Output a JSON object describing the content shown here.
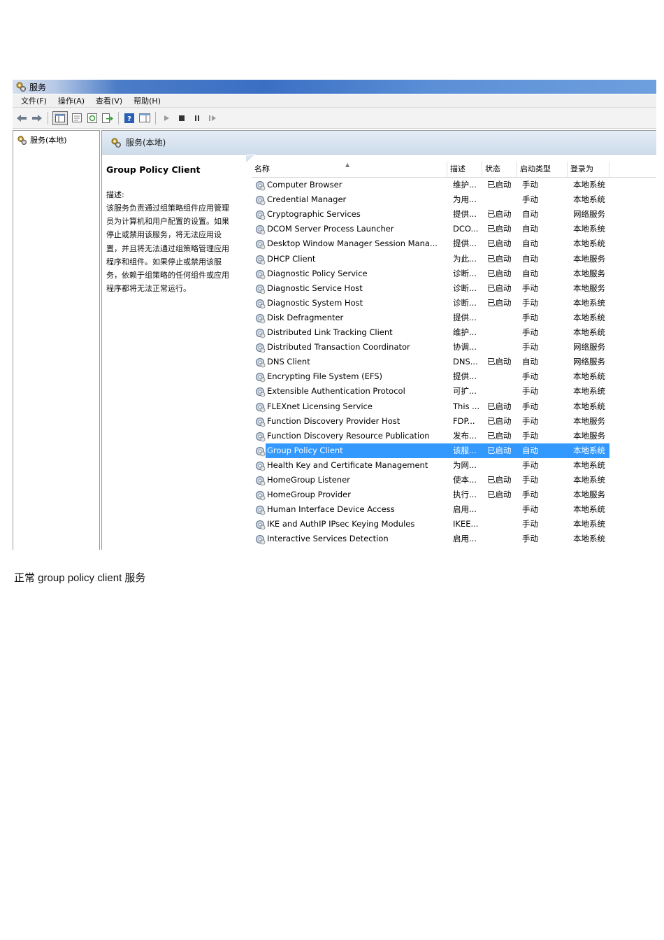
{
  "window": {
    "title": "服务",
    "menu": [
      "文件(F)",
      "操作(A)",
      "查看(V)",
      "帮助(H)"
    ],
    "toolbar_icons": [
      "back-icon",
      "forward-icon",
      "console-tree-icon",
      "properties-icon",
      "refresh-icon",
      "export-icon",
      "help-icon",
      "view-icon",
      "play-icon",
      "stop-icon",
      "pause-icon",
      "restart-icon"
    ]
  },
  "tree": {
    "root": "服务(本地)"
  },
  "panel": {
    "header": "服务(本地)",
    "desc_title": "Group Policy Client",
    "desc_label": "描述:",
    "desc_lines": [
      "该服务负责通过组策略组件应用管理",
      "员为计算机和用户配置的设置。如果",
      "停止或禁用该服务，将无法应用设",
      "置，并且将无法通过组策略管理应用",
      "程序和组件。如果停止或禁用该服",
      "务，依赖于组策略的任何组件或应用",
      "程序都将无法正常运行。"
    ]
  },
  "columns": [
    "名称",
    "描述",
    "状态",
    "启动类型",
    "登录为"
  ],
  "services": [
    {
      "name": "Computer Browser",
      "desc": "维护...",
      "status": "已启动",
      "start": "手动",
      "logon": "本地系统"
    },
    {
      "name": "Credential Manager",
      "desc": "为用...",
      "status": "",
      "start": "手动",
      "logon": "本地系统"
    },
    {
      "name": "Cryptographic Services",
      "desc": "提供...",
      "status": "已启动",
      "start": "自动",
      "logon": "网络服务"
    },
    {
      "name": "DCOM Server Process Launcher",
      "desc": "DCO...",
      "status": "已启动",
      "start": "自动",
      "logon": "本地系统"
    },
    {
      "name": "Desktop Window Manager Session Mana...",
      "desc": "提供...",
      "status": "已启动",
      "start": "自动",
      "logon": "本地系统"
    },
    {
      "name": "DHCP Client",
      "desc": "为此...",
      "status": "已启动",
      "start": "自动",
      "logon": "本地服务"
    },
    {
      "name": "Diagnostic Policy Service",
      "desc": "诊断...",
      "status": "已启动",
      "start": "自动",
      "logon": "本地服务"
    },
    {
      "name": "Diagnostic Service Host",
      "desc": "诊断...",
      "status": "已启动",
      "start": "手动",
      "logon": "本地服务"
    },
    {
      "name": "Diagnostic System Host",
      "desc": "诊断...",
      "status": "已启动",
      "start": "手动",
      "logon": "本地系统"
    },
    {
      "name": "Disk Defragmenter",
      "desc": "提供...",
      "status": "",
      "start": "手动",
      "logon": "本地系统"
    },
    {
      "name": "Distributed Link Tracking Client",
      "desc": "维护...",
      "status": "",
      "start": "手动",
      "logon": "本地系统"
    },
    {
      "name": "Distributed Transaction Coordinator",
      "desc": "协调...",
      "status": "",
      "start": "手动",
      "logon": "网络服务"
    },
    {
      "name": "DNS Client",
      "desc": "DNS...",
      "status": "已启动",
      "start": "自动",
      "logon": "网络服务"
    },
    {
      "name": "Encrypting File System (EFS)",
      "desc": "提供...",
      "status": "",
      "start": "手动",
      "logon": "本地系统"
    },
    {
      "name": "Extensible Authentication Protocol",
      "desc": "可扩...",
      "status": "",
      "start": "手动",
      "logon": "本地系统"
    },
    {
      "name": "FLEXnet Licensing Service",
      "desc": "This ...",
      "status": "已启动",
      "start": "手动",
      "logon": "本地系统"
    },
    {
      "name": "Function Discovery Provider Host",
      "desc": "FDP...",
      "status": "已启动",
      "start": "手动",
      "logon": "本地服务"
    },
    {
      "name": "Function Discovery Resource Publication",
      "desc": "发布...",
      "status": "已启动",
      "start": "手动",
      "logon": "本地服务"
    },
    {
      "name": "Group Policy Client",
      "desc": "该服...",
      "status": "已启动",
      "start": "自动",
      "logon": "本地系统",
      "selected": true
    },
    {
      "name": "Health Key and Certificate Management",
      "desc": "为网...",
      "status": "",
      "start": "手动",
      "logon": "本地系统"
    },
    {
      "name": "HomeGroup Listener",
      "desc": "使本...",
      "status": "已启动",
      "start": "手动",
      "logon": "本地系统"
    },
    {
      "name": "HomeGroup Provider",
      "desc": "执行...",
      "status": "已启动",
      "start": "手动",
      "logon": "本地服务"
    },
    {
      "name": "Human Interface Device Access",
      "desc": "启用...",
      "status": "",
      "start": "手动",
      "logon": "本地系统"
    },
    {
      "name": "IKE and AuthIP IPsec Keying Modules",
      "desc": "IKEE...",
      "status": "",
      "start": "手动",
      "logon": "本地系统"
    },
    {
      "name": "Interactive Services Detection",
      "desc": "启用...",
      "status": "",
      "start": "手动",
      "logon": "本地系统"
    }
  ],
  "caption": "正常 group policy client  服务"
}
